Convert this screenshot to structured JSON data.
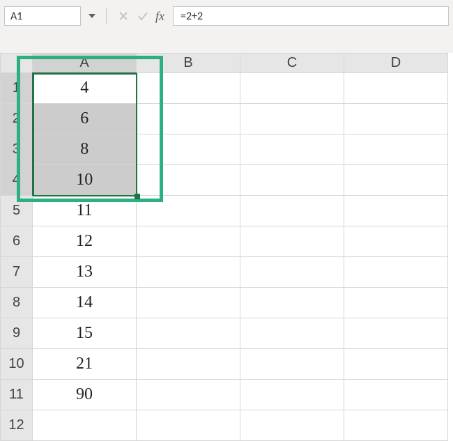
{
  "namebox": {
    "value": "A1"
  },
  "formula_bar": {
    "fx_label": "fx",
    "value": "=2+2"
  },
  "columns": [
    "A",
    "B",
    "C",
    "D"
  ],
  "rows": [
    1,
    2,
    3,
    4,
    5,
    6,
    7,
    8,
    9,
    10,
    11,
    12
  ],
  "cells": {
    "A1": 4,
    "A2": 6,
    "A3": 8,
    "A4": 10,
    "A5": 11,
    "A6": 12,
    "A7": 13,
    "A8": 14,
    "A9": 15,
    "A10": 21,
    "A11": 90
  },
  "selection": {
    "active_cell": "A1",
    "range": "A1:A4"
  },
  "colors": {
    "selection_border": "#217346",
    "highlight_border": "#2ab17f"
  }
}
